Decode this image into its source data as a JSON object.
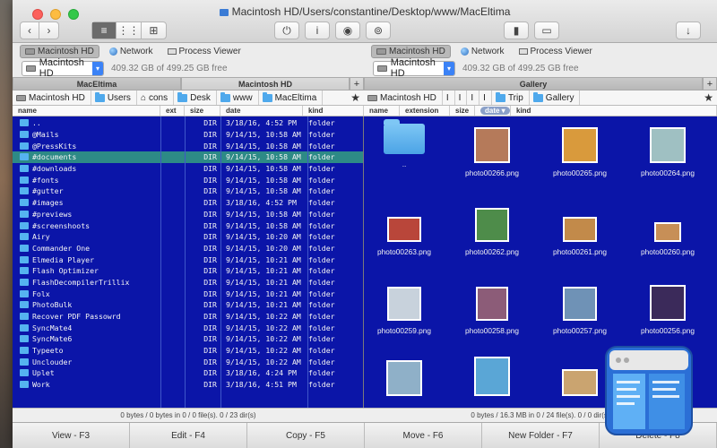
{
  "window": {
    "title": "Macintosh HD/Users/constantine/Desktop/www/MacEltima"
  },
  "toolbar": {
    "back": "‹",
    "forward": "›",
    "toggle": "⏻",
    "info": "i",
    "eye": "◉",
    "binoculars": "⊚",
    "archive": "▮",
    "monitor": "▭",
    "download": "↓"
  },
  "left": {
    "devices": [
      "Macintosh HD",
      "Network",
      "Process Viewer"
    ],
    "drive": "Macintosh HD",
    "free": "409.32 GB of 499.25 GB free",
    "tabs": [
      "MacEltima",
      "Macintosh HD"
    ],
    "path": [
      "Macintosh HD",
      "Users",
      "cons",
      "Desk",
      "www",
      "MacEltima"
    ],
    "columns": [
      "name",
      "ext",
      "size",
      "date",
      "kind"
    ],
    "rows": [
      {
        "name": "..",
        "size": "DIR",
        "date": "3/18/16, 4:52 PM",
        "kind": "folder"
      },
      {
        "name": "@Mails",
        "size": "DIR",
        "date": "9/14/15, 10:58 AM",
        "kind": "folder"
      },
      {
        "name": "@PressKits",
        "size": "DIR",
        "date": "9/14/15, 10:58 AM",
        "kind": "folder"
      },
      {
        "name": "#documents",
        "size": "DIR",
        "date": "9/14/15, 10:58 AM",
        "kind": "folder"
      },
      {
        "name": "#downloads",
        "size": "DIR",
        "date": "9/14/15, 10:58 AM",
        "kind": "folder"
      },
      {
        "name": "#fonts",
        "size": "DIR",
        "date": "9/14/15, 10:58 AM",
        "kind": "folder"
      },
      {
        "name": "#gutter",
        "size": "DIR",
        "date": "9/14/15, 10:58 AM",
        "kind": "folder"
      },
      {
        "name": "#images",
        "size": "DIR",
        "date": "3/18/16, 4:52 PM",
        "kind": "folder"
      },
      {
        "name": "#previews",
        "size": "DIR",
        "date": "9/14/15, 10:58 AM",
        "kind": "folder"
      },
      {
        "name": "#screenshoots",
        "size": "DIR",
        "date": "9/14/15, 10:58 AM",
        "kind": "folder"
      },
      {
        "name": "Airy",
        "size": "DIR",
        "date": "9/14/15, 10:20 AM",
        "kind": "folder"
      },
      {
        "name": "Commander One",
        "size": "DIR",
        "date": "9/14/15, 10:20 AM",
        "kind": "folder"
      },
      {
        "name": "Elmedia Player",
        "size": "DIR",
        "date": "9/14/15, 10:21 AM",
        "kind": "folder"
      },
      {
        "name": "Flash Optimizer",
        "size": "DIR",
        "date": "9/14/15, 10:21 AM",
        "kind": "folder"
      },
      {
        "name": "FlashDecompilerTrillix",
        "size": "DIR",
        "date": "9/14/15, 10:21 AM",
        "kind": "folder"
      },
      {
        "name": "Folx",
        "size": "DIR",
        "date": "9/14/15, 10:21 AM",
        "kind": "folder"
      },
      {
        "name": "PhotoBulk",
        "size": "DIR",
        "date": "9/14/15, 10:21 AM",
        "kind": "folder"
      },
      {
        "name": "Recover PDF Passowrd",
        "size": "DIR",
        "date": "9/14/15, 10:22 AM",
        "kind": "folder"
      },
      {
        "name": "SyncMate4",
        "size": "DIR",
        "date": "9/14/15, 10:22 AM",
        "kind": "folder"
      },
      {
        "name": "SyncMate6",
        "size": "DIR",
        "date": "9/14/15, 10:22 AM",
        "kind": "folder"
      },
      {
        "name": "Typeeto",
        "size": "DIR",
        "date": "9/14/15, 10:22 AM",
        "kind": "folder"
      },
      {
        "name": "Unclouder",
        "size": "DIR",
        "date": "9/14/15, 10:22 AM",
        "kind": "folder"
      },
      {
        "name": "Uplet",
        "size": "DIR",
        "date": "3/18/16, 4:24 PM",
        "kind": "folder"
      },
      {
        "name": "Work",
        "size": "DIR",
        "date": "3/18/16, 4:51 PM",
        "kind": "folder"
      }
    ],
    "status": "0 bytes / 0 bytes in 0 / 0 file(s). 0 / 23 dir(s)"
  },
  "right": {
    "devices": [
      "Macintosh HD",
      "Network",
      "Process Viewer"
    ],
    "drive": "Macintosh HD",
    "free": "409.32 GB of 499.25 GB free",
    "tabs": [
      "Gallery"
    ],
    "path": [
      "Macintosh HD",
      "I",
      "I",
      "I",
      "I",
      "Trip",
      "Gallery"
    ],
    "columns": [
      "name",
      "extension",
      "size",
      "date",
      "kind"
    ],
    "items": [
      {
        "name": "..",
        "color": "folder"
      },
      {
        "name": "photo00266.png",
        "color": "#b57a5a"
      },
      {
        "name": "photo00265.png",
        "color": "#d99a3c"
      },
      {
        "name": "photo00264.png",
        "color": "#9fc0c2"
      },
      {
        "name": "photo00263.png",
        "color": "#b9463a"
      },
      {
        "name": "photo00262.png",
        "color": "#4e8c4a"
      },
      {
        "name": "photo00261.png",
        "color": "#c28a4a"
      },
      {
        "name": "photo00260.png",
        "color": "#c78f57"
      },
      {
        "name": "photo00259.png",
        "color": "#c8d2dc"
      },
      {
        "name": "photo00258.png",
        "color": "#8c5c78"
      },
      {
        "name": "photo00257.png",
        "color": "#6f92b6"
      },
      {
        "name": "photo00256.png",
        "color": "#3b2a5a"
      },
      {
        "name": "",
        "color": "#8fb0c8"
      },
      {
        "name": "",
        "color": "#5aa6d6"
      },
      {
        "name": "",
        "color": "#caa470"
      }
    ],
    "status": "0 bytes / 16.3 MB in 0 / 24 file(s). 0 / 0 dir(s)"
  },
  "fkeys": [
    "View - F3",
    "Edit - F4",
    "Copy - F5",
    "Move - F6",
    "New Folder - F7",
    "Delete - F8"
  ]
}
